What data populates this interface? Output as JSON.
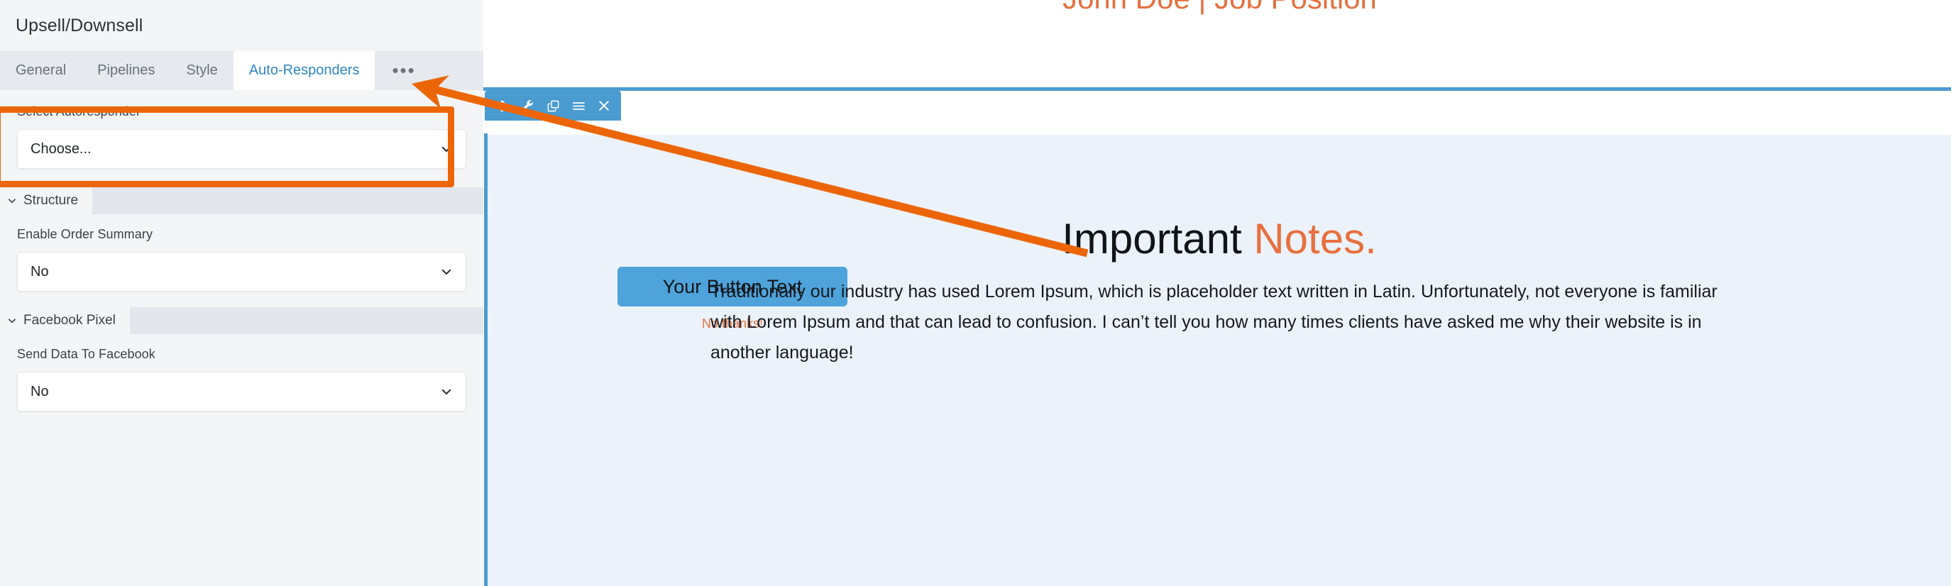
{
  "panel": {
    "title": "Upsell/Downsell",
    "scrollbar_name": "panel-scrollbar",
    "tabs": [
      {
        "id": "general",
        "label": "General",
        "active": false
      },
      {
        "id": "pipelines",
        "label": "Pipelines",
        "active": false
      },
      {
        "id": "style",
        "label": "Style",
        "active": false
      },
      {
        "id": "auto-responders",
        "label": "Auto-Responders",
        "active": true
      }
    ],
    "overflow_tab_label": "•••",
    "autoresponder": {
      "label": "Select Autoresponder",
      "value": "Choose...",
      "highlighted": true,
      "highlight_color": "#ec6608"
    },
    "sections": [
      {
        "id": "structure",
        "header": "Structure",
        "collapsed": false,
        "field_label": "Enable Order Summary",
        "field_value": "No"
      },
      {
        "id": "facebook-pixel",
        "header": "Facebook Pixel",
        "collapsed": false,
        "field_label": "Send Data To Facebook",
        "field_value": "No"
      }
    ]
  },
  "canvas": {
    "hero_headline": "John Doe | Job Position",
    "toolbar": {
      "buttons": [
        {
          "id": "move",
          "icon": "move-arrows-icon",
          "title": "Move"
        },
        {
          "id": "settings",
          "icon": "wrench-icon",
          "title": "Settings"
        },
        {
          "id": "duplicate",
          "icon": "copy-icon",
          "title": "Duplicate"
        },
        {
          "id": "menu",
          "icon": "hamburger-menu-icon",
          "title": "Menu"
        },
        {
          "id": "close",
          "icon": "close-x-icon",
          "title": "Delete"
        }
      ]
    },
    "cta_button_label": "Your Button Text",
    "decline_link_label": "No thanks!",
    "notes_heading_main": "Important ",
    "notes_heading_accent": "Notes.",
    "notes_paragraph": "Traditionally our industry has used Lorem Ipsum, which is placeholder text written in Latin. Unfortunately, not everyone is familiar with Lorem Ipsum and that can lead to confusion. I can’t tell you how many times clients have asked me why their website is in another language!"
  },
  "colors": {
    "accent_orange": "#ec6608",
    "brand_blue": "#4a9bcf",
    "cta_blue": "#4fa3db",
    "text_orange": "#e8703e",
    "section_bg": "#ebf2fa",
    "panel_bg": "#f4f5f7",
    "tab_active_text": "#2f85c4"
  }
}
